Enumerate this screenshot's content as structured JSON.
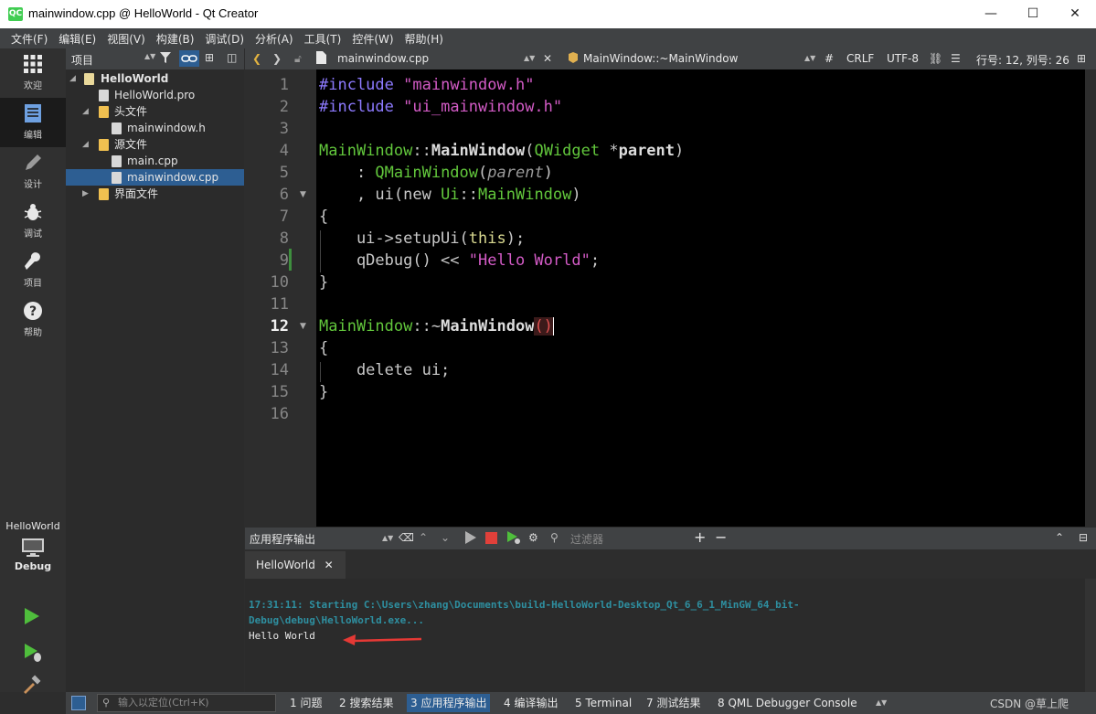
{
  "window": {
    "title": "mainwindow.cpp @ HelloWorld - Qt Creator",
    "logo": "QC",
    "controls": [
      "—",
      "☐",
      "✕"
    ]
  },
  "menu": [
    "文件(F)",
    "编辑(E)",
    "视图(V)",
    "构建(B)",
    "调试(D)",
    "分析(A)",
    "工具(T)",
    "控件(W)",
    "帮助(H)"
  ],
  "modes": [
    {
      "label": "欢迎",
      "icon": "grid-icon"
    },
    {
      "label": "编辑",
      "icon": "document-icon"
    },
    {
      "label": "设计",
      "icon": "pencil-icon"
    },
    {
      "label": "调试",
      "icon": "bug-icon"
    },
    {
      "label": "项目",
      "icon": "wrench-icon"
    },
    {
      "label": "帮助",
      "icon": "help-icon"
    }
  ],
  "kit": {
    "project": "HelloWorld",
    "config": "Debug"
  },
  "project_panel": {
    "title": "项目",
    "tree": [
      {
        "label": "HelloWorld",
        "level": 0,
        "bold": true,
        "expanded": true
      },
      {
        "label": "HelloWorld.pro",
        "level": 1
      },
      {
        "label": "头文件",
        "level": 1,
        "folder": true,
        "expanded": true
      },
      {
        "label": "mainwindow.h",
        "level": 2
      },
      {
        "label": "源文件",
        "level": 1,
        "folder": true,
        "expanded": true
      },
      {
        "label": "main.cpp",
        "level": 2
      },
      {
        "label": "mainwindow.cpp",
        "level": 2,
        "selected": true
      },
      {
        "label": "界面文件",
        "level": 1,
        "folder": true,
        "expanded": false
      }
    ]
  },
  "editor_toolbar": {
    "file": "mainwindow.cpp",
    "symbol": "MainWindow::~MainWindow",
    "hash": "#",
    "line_ending": "CRLF",
    "encoding": "UTF-8",
    "position": "行号: 12, 列号: 26"
  },
  "code": {
    "line_numbers": [
      "1",
      "2",
      "3",
      "4",
      "5",
      "6",
      "7",
      "8",
      "9",
      "10",
      "11",
      "12",
      "13",
      "14",
      "15",
      "16"
    ],
    "current_line": "12"
  },
  "output": {
    "title": "应用程序输出",
    "filter_placeholder": "过滤器",
    "tab": "HelloWorld",
    "lines": [
      "17:31:11: Starting C:\\Users\\zhang\\Documents\\build-HelloWorld-Desktop_Qt_6_6_1_MinGW_64_bit-",
      "Debug\\debug\\HelloWorld.exe...",
      "Hello World"
    ]
  },
  "status": {
    "locator_placeholder": "输入以定位(Ctrl+K)",
    "tabs": [
      "1 问题",
      "2 搜索结果",
      "3 应用程序输出",
      "4 编译输出",
      "5 Terminal",
      "7 测试结果",
      "8 QML Debugger Console"
    ],
    "active_tab": "3 应用程序输出",
    "watermark": "CSDN @草上爬"
  },
  "colors": {
    "accent": "#2d5e92",
    "qt_green": "#41cd52",
    "run_green": "#4fbe3c",
    "stop_red": "#e0403a",
    "arrow_red": "#e53935"
  }
}
